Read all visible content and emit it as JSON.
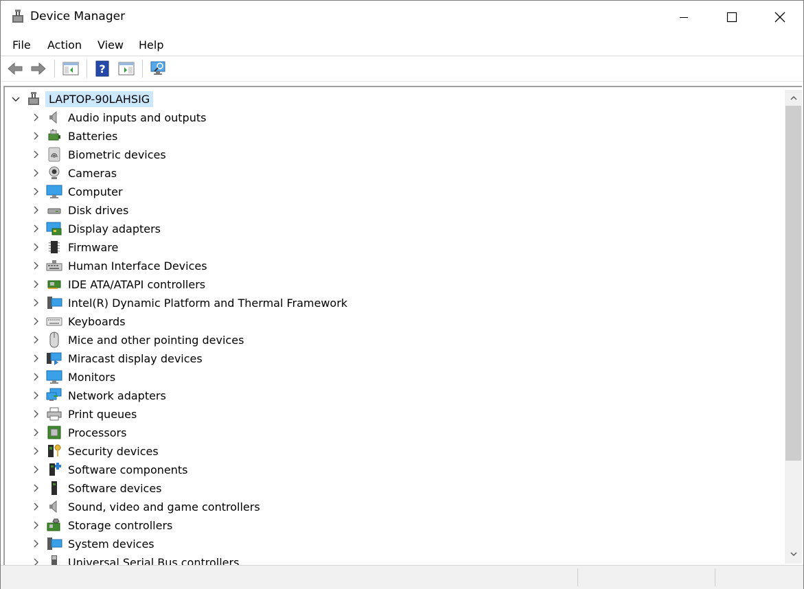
{
  "window": {
    "title": "Device Manager"
  },
  "menu": {
    "items": [
      "File",
      "Action",
      "View",
      "Help"
    ]
  },
  "toolbar": {
    "buttons": [
      "back-arrow-icon",
      "forward-arrow-icon",
      "show-hide-console-tree-icon",
      "help-icon",
      "properties-icon",
      "scan-hardware-icon"
    ]
  },
  "tree": {
    "root": {
      "label": "LAPTOP-90LAHSIG",
      "expanded": true,
      "selected": true
    },
    "items": [
      {
        "label": "Audio inputs and outputs",
        "icon": "speaker-icon"
      },
      {
        "label": "Batteries",
        "icon": "battery-icon"
      },
      {
        "label": "Biometric devices",
        "icon": "fingerprint-icon"
      },
      {
        "label": "Cameras",
        "icon": "webcam-icon"
      },
      {
        "label": "Computer",
        "icon": "monitor-icon"
      },
      {
        "label": "Disk drives",
        "icon": "disk-drive-icon"
      },
      {
        "label": "Display adapters",
        "icon": "display-adapter-icon"
      },
      {
        "label": "Firmware",
        "icon": "chip-icon"
      },
      {
        "label": "Human Interface Devices",
        "icon": "hid-icon"
      },
      {
        "label": "IDE ATA/ATAPI controllers",
        "icon": "controller-card-icon"
      },
      {
        "label": "Intel(R) Dynamic Platform and Thermal Framework",
        "icon": "system-icon"
      },
      {
        "label": "Keyboards",
        "icon": "keyboard-icon"
      },
      {
        "label": "Mice and other pointing devices",
        "icon": "mouse-icon"
      },
      {
        "label": "Miracast display devices",
        "icon": "miracast-icon"
      },
      {
        "label": "Monitors",
        "icon": "monitor-icon"
      },
      {
        "label": "Network adapters",
        "icon": "network-adapter-icon"
      },
      {
        "label": "Print queues",
        "icon": "printer-icon"
      },
      {
        "label": "Processors",
        "icon": "processor-icon"
      },
      {
        "label": "Security devices",
        "icon": "security-key-icon"
      },
      {
        "label": "Software components",
        "icon": "software-component-icon"
      },
      {
        "label": "Software devices",
        "icon": "software-device-icon"
      },
      {
        "label": "Sound, video and game controllers",
        "icon": "speaker-icon"
      },
      {
        "label": "Storage controllers",
        "icon": "storage-controller-icon"
      },
      {
        "label": "System devices",
        "icon": "system-icon"
      },
      {
        "label": "Universal Serial Bus controllers",
        "icon": "usb-icon"
      }
    ]
  },
  "colors": {
    "selection": "#cce8ff",
    "accent_blue": "#2e8bd8",
    "scroll_thumb": "#cdcdcd"
  }
}
